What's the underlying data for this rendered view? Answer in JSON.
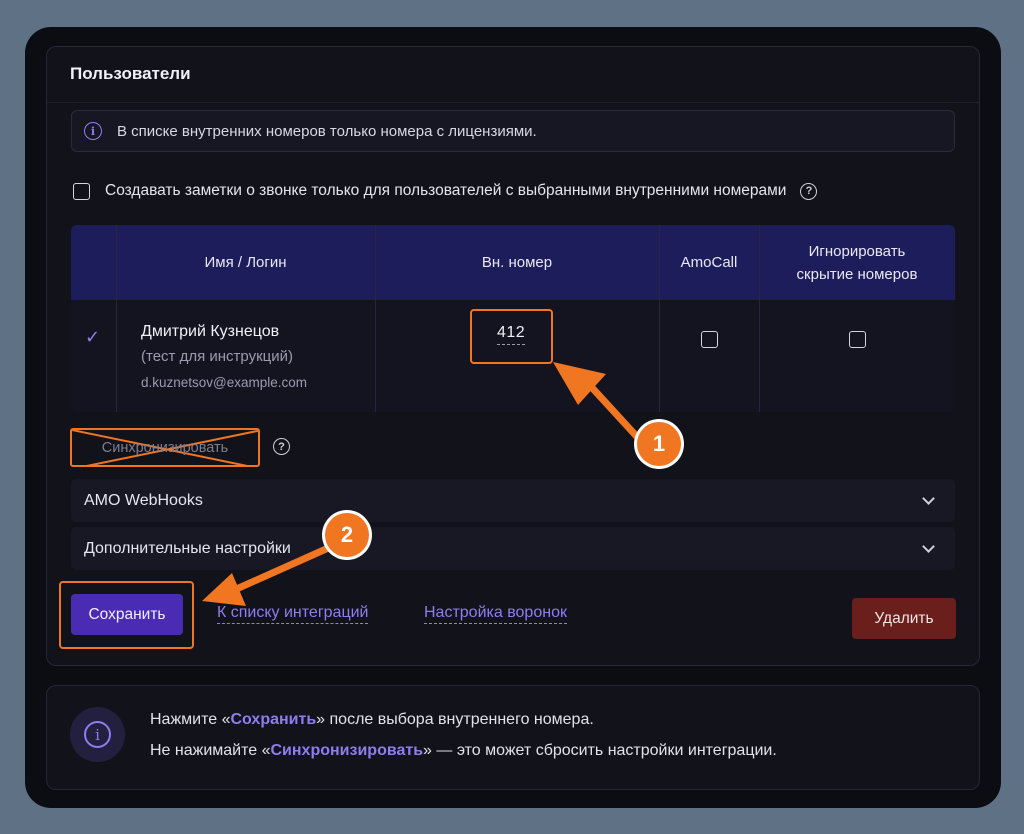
{
  "panel": {
    "title": "Пользователи",
    "notice": "В списке внутренних номеров только номера с лицензиями.",
    "notes_checkbox_label": "Создавать заметки о звонке только для пользователей с выбранными внутренними номерами"
  },
  "table": {
    "headers": {
      "name": "Имя / Логин",
      "ext": "Вн. номер",
      "amocall": "AmoCall",
      "ignore_line1": "Игнорировать",
      "ignore_line2": "скрытие номеров"
    },
    "rows": [
      {
        "selected_mark": "✓",
        "name": "Дмитрий Кузнецов",
        "note": "(тест для инструкций)",
        "email": "d.kuznetsov@example.com",
        "ext": "412",
        "amocall": false,
        "ignore_hidden": false
      }
    ]
  },
  "sync_button": "Синхронизировать",
  "accordions": {
    "webhooks": "AMO WebHooks",
    "advanced": "Дополнительные настройки"
  },
  "actions": {
    "save": "Сохранить",
    "to_list": "К списку интеграций",
    "funnels": "Настройка воронок",
    "delete": "Удалить"
  },
  "badges": {
    "one": "1",
    "two": "2"
  },
  "footer": {
    "line1_pre": "Нажмите «",
    "line1_bold": "Сохранить",
    "line1_post": "» после выбора внутреннего номера.",
    "line2_pre": "Не нажимайте «",
    "line2_bold": "Синхронизировать",
    "line2_post": "» — это может сбросить настройки интеграции."
  },
  "icons": {
    "info": "info-icon",
    "help": "question-circle-icon",
    "chevron": "chevron-down-icon",
    "check": "checkmark-icon"
  },
  "colors": {
    "accent": "#8f7cf0",
    "highlight": "#f07621",
    "save": "#4a2bb4",
    "delete": "#6a1f1c",
    "table_header": "#1d1d5c"
  }
}
